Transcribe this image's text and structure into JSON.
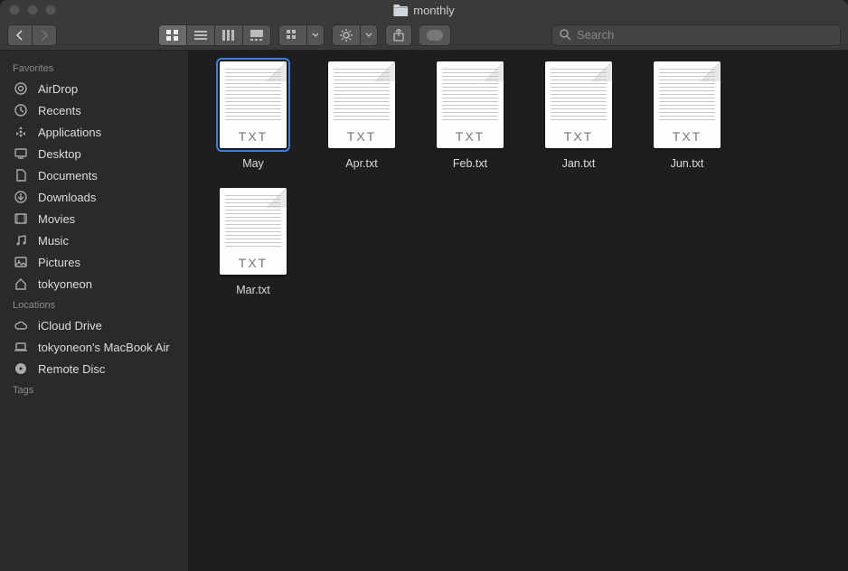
{
  "window": {
    "title": "monthly"
  },
  "toolbar": {
    "search_placeholder": "Search"
  },
  "sidebar": {
    "favorites_title": "Favorites",
    "favorites": [
      {
        "icon": "airdrop",
        "label": "AirDrop"
      },
      {
        "icon": "clock",
        "label": "Recents"
      },
      {
        "icon": "apps",
        "label": "Applications"
      },
      {
        "icon": "desktop",
        "label": "Desktop"
      },
      {
        "icon": "doc",
        "label": "Documents"
      },
      {
        "icon": "download",
        "label": "Downloads"
      },
      {
        "icon": "movies",
        "label": "Movies"
      },
      {
        "icon": "music",
        "label": "Music"
      },
      {
        "icon": "pictures",
        "label": "Pictures"
      },
      {
        "icon": "home",
        "label": "tokyoneon"
      }
    ],
    "locations_title": "Locations",
    "locations": [
      {
        "icon": "cloud",
        "label": "iCloud Drive"
      },
      {
        "icon": "laptop",
        "label": "tokyoneon's MacBook Air"
      },
      {
        "icon": "disc",
        "label": "Remote Disc"
      }
    ],
    "tags_title": "Tags"
  },
  "files": [
    {
      "name": "May",
      "badge": "TXT",
      "selected": true
    },
    {
      "name": "Apr.txt",
      "badge": "TXT",
      "selected": false
    },
    {
      "name": "Feb.txt",
      "badge": "TXT",
      "selected": false
    },
    {
      "name": "Jan.txt",
      "badge": "TXT",
      "selected": false
    },
    {
      "name": "Jun.txt",
      "badge": "TXT",
      "selected": false
    },
    {
      "name": "Mar.txt",
      "badge": "TXT",
      "selected": false
    }
  ]
}
